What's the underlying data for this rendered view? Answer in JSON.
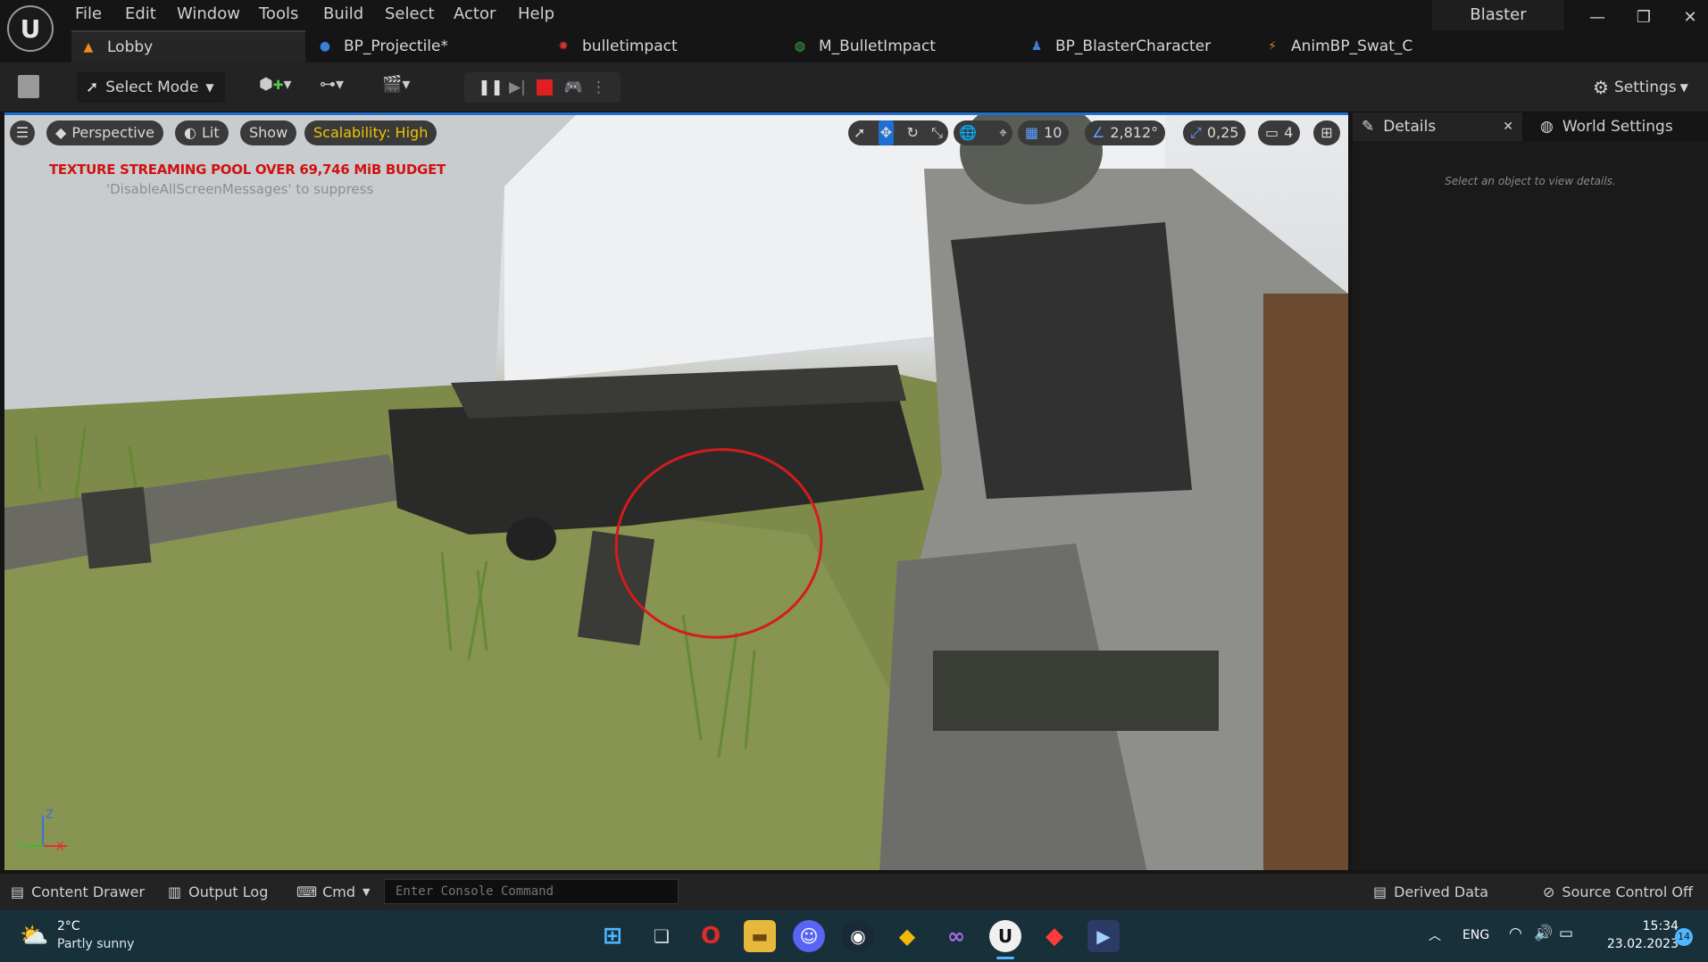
{
  "menu": [
    "File",
    "Edit",
    "Window",
    "Tools",
    "Build",
    "Select",
    "Actor",
    "Help"
  ],
  "project_name": "Blaster",
  "tabs": [
    {
      "label": "Lobby",
      "icon": "level-icon"
    },
    {
      "label": "BP_Projectile*",
      "icon": "blueprint-icon"
    },
    {
      "label": "bulletimpact",
      "icon": "particle-icon"
    },
    {
      "label": "M_BulletImpact",
      "icon": "material-icon"
    },
    {
      "label": "BP_BlasterCharacter",
      "icon": "blueprint-icon"
    },
    {
      "label": "AnimBP_Swat_C",
      "icon": "animation-icon"
    }
  ],
  "toolbar": {
    "select_mode": "Select Mode",
    "settings": "Settings"
  },
  "viewport": {
    "perspective": "Perspective",
    "lit": "Lit",
    "show": "Show",
    "scalability": "Scalability: High",
    "grid_snap": "10",
    "rotation_snap": "2,812°",
    "scale_snap": "0,25",
    "camera_speed": "4",
    "warning": "TEXTURE STREAMING POOL OVER 69,746 MiB BUDGET",
    "warning_hint": "'DisableAllScreenMessages' to suppress",
    "axis_z": "Z",
    "axis_x": "X",
    "axis_y": "Y"
  },
  "details": {
    "tab": "Details",
    "world_settings": "World Settings",
    "empty": "Select an object to view details."
  },
  "bottom": {
    "content_drawer": "Content Drawer",
    "output_log": "Output Log",
    "cmd": "Cmd",
    "console_placeholder": "Enter Console Command",
    "derived_data": "Derived Data",
    "source_control": "Source Control Off"
  },
  "taskbar": {
    "temp": "2°C",
    "weather": "Partly sunny",
    "lang": "ENG",
    "time": "15:34",
    "date": "23.02.2023",
    "notifications": "14"
  },
  "colors": {
    "warning": "#d01212",
    "scalability": "#f2c200",
    "accent": "#1f6fd0",
    "taskbar": "#17303a"
  }
}
